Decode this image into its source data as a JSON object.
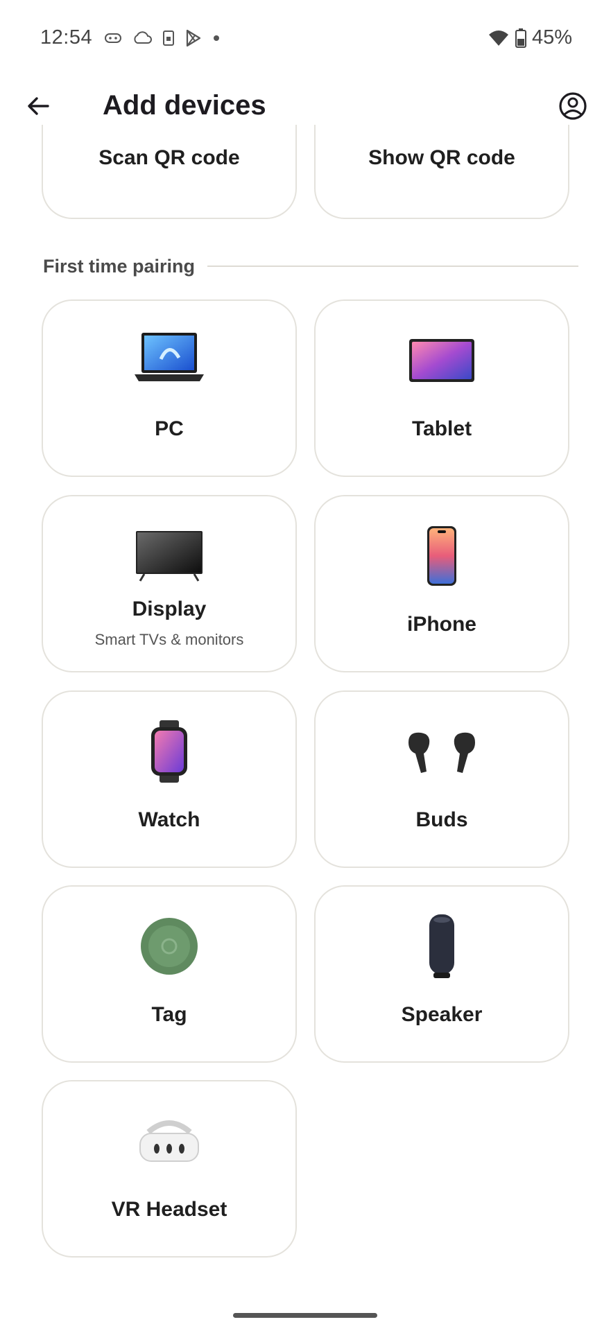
{
  "status": {
    "time": "12:54",
    "battery": "45%",
    "icons": [
      "gamepad-icon",
      "cloud-icon",
      "sim-icon",
      "play-store-icon",
      "dot-icon",
      "wifi-icon",
      "battery-icon"
    ]
  },
  "appbar": {
    "title": "Add devices",
    "back_icon": "arrow-back-icon",
    "account_icon": "account-circle-icon"
  },
  "qr": {
    "scan_label": "Scan QR code",
    "show_label": "Show QR code"
  },
  "section": {
    "title": "First time pairing"
  },
  "devices": [
    {
      "label": "PC",
      "icon": "laptop-icon"
    },
    {
      "label": "Tablet",
      "icon": "tablet-icon"
    },
    {
      "label": "Display",
      "sub": "Smart TVs & monitors",
      "icon": "tv-icon"
    },
    {
      "label": "iPhone",
      "icon": "phone-icon"
    },
    {
      "label": "Watch",
      "icon": "watch-icon"
    },
    {
      "label": "Buds",
      "icon": "earbuds-icon"
    },
    {
      "label": "Tag",
      "icon": "tag-icon"
    },
    {
      "label": "Speaker",
      "icon": "speaker-icon"
    },
    {
      "label": "VR Headset",
      "icon": "vr-headset-icon"
    }
  ]
}
